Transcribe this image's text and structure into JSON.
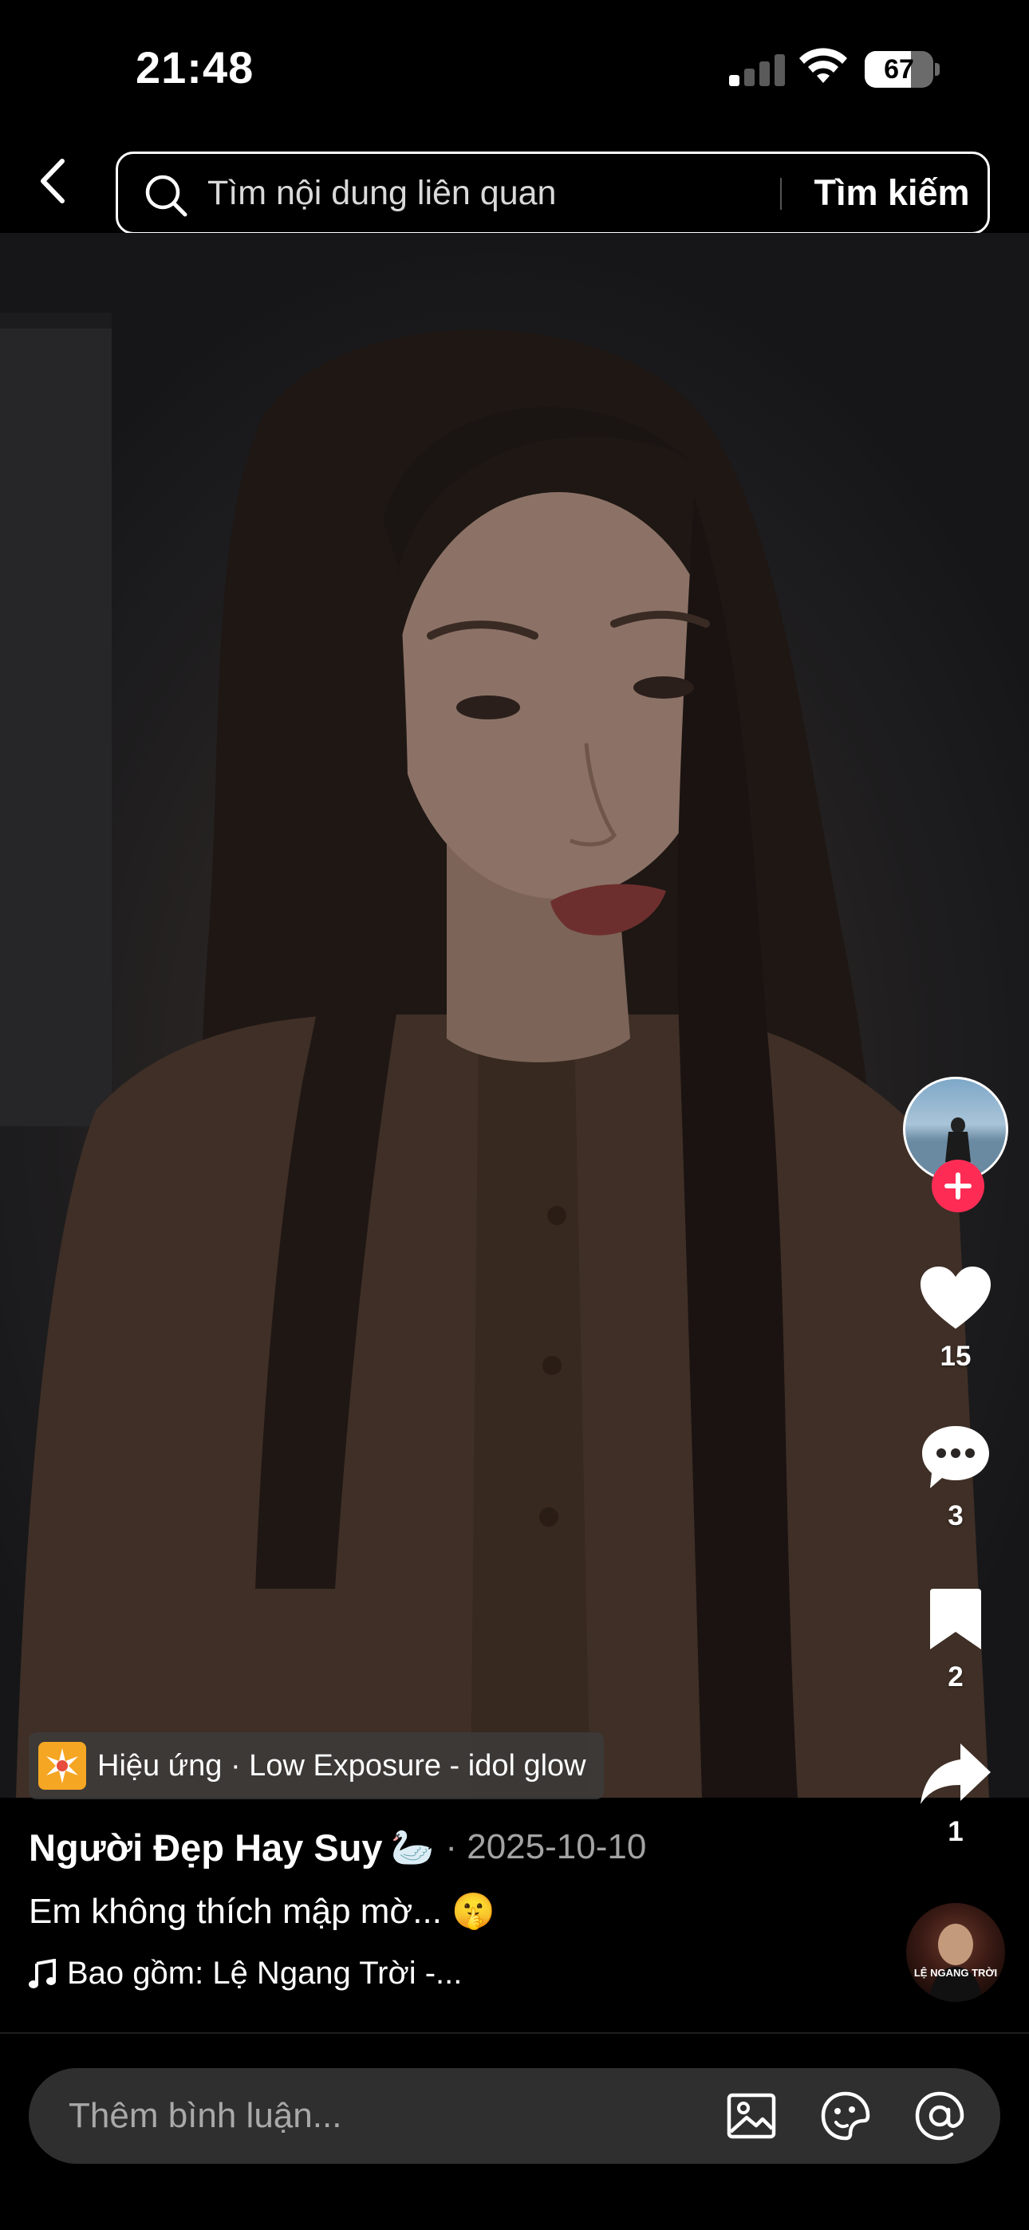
{
  "status_bar": {
    "time": "21:48",
    "battery_percent": 67,
    "battery_label": "67",
    "signal_bars_active": 1,
    "signal_bars_total": 4
  },
  "header": {
    "back_icon": "chevron-left-icon",
    "search_placeholder": "Tìm nội dung liên quan",
    "search_button_label": "Tìm kiếm"
  },
  "rail": {
    "likes": "15",
    "comments": "3",
    "bookmarks": "2",
    "shares": "1"
  },
  "effect": {
    "label": "Hiệu ứng · Low Exposure - idol glow"
  },
  "post": {
    "author": "Người Đẹp Hay Suy",
    "author_emoji": "🦢",
    "date": "· 2025-10-10",
    "caption": "Em không thích mập mờ... 🤫",
    "music": "Bao gồm: Lệ Ngang Trời -...",
    "music_disc_label": "LỆ NGANG TRỜI"
  },
  "comment_bar": {
    "placeholder": "Thêm bình luận..."
  },
  "colors": {
    "accent": "#fe2c55",
    "background": "#000000",
    "comment_bar": "#2f2f2f",
    "effect_icon": "#f5a623"
  }
}
